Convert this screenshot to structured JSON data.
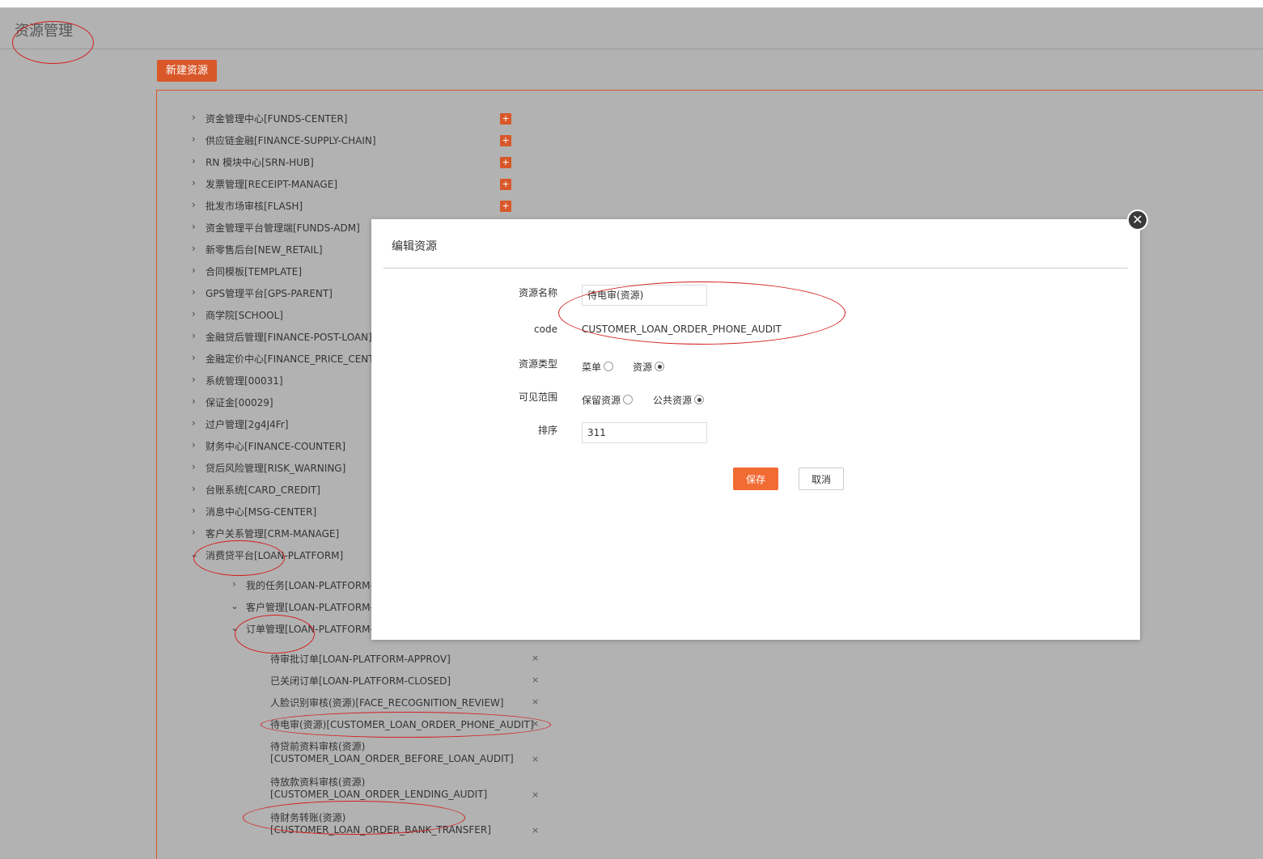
{
  "page": {
    "title": "资源管理",
    "new_button": "新建资源"
  },
  "icons": {
    "chevron_right": "›",
    "chevron_down": "⌄",
    "plus": "+",
    "delete": "×",
    "close": "✕"
  },
  "tree": {
    "top_level": [
      "资金管理中心[FUNDS-CENTER]",
      "供应链金融[FINANCE-SUPPLY-CHAIN]",
      "RN 模块中心[SRN-HUB]",
      "发票管理[RECEIPT-MANAGE]",
      "批发市场审核[FLASH]",
      "资金管理平台管理端[FUNDS-ADM]",
      "新零售后台[NEW_RETAIL]",
      "合同模板[TEMPLATE]",
      "GPS管理平台[GPS-PARENT]",
      "商学院[SCHOOL]",
      "金融贷后管理[FINANCE-POST-LOAN]",
      "金融定价中心[FINANCE_PRICE_CENTER",
      "系统管理[00031]",
      "保证金[00029]",
      "过户管理[2g4J4Fr]",
      "财务中心[FINANCE-COUNTER]",
      "贷后风险管理[RISK_WARNING]",
      "台账系统[CARD_CREDIT]",
      "消息中心[MSG-CENTER]",
      "客户关系管理[CRM-MANAGE]",
      "消费贷平台[LOAN-PLATFORM]"
    ],
    "children": [
      "我的任务[LOAN-PLATFORM-M",
      "客户管理[LOAN-PLATFORM-C",
      "订单管理[LOAN-PLATFORM-C"
    ],
    "grandchildren": [
      {
        "line1": "待审批订单[LOAN-PLATFORM-APPROV]",
        "line2": ""
      },
      {
        "line1": "已关闭订单[LOAN-PLATFORM-CLOSED]",
        "line2": ""
      },
      {
        "line1": "人脸识别审核(资源)[FACE_RECOGNITION_REVIEW]",
        "line2": ""
      },
      {
        "line1": "待电审(资源)[CUSTOMER_LOAN_ORDER_PHONE_AUDIT]",
        "line2": ""
      },
      {
        "line1": "待贷前资料审核(资源)",
        "line2": "[CUSTOMER_LOAN_ORDER_BEFORE_LOAN_AUDIT]"
      },
      {
        "line1": "待放款资料审核(资源)",
        "line2": "[CUSTOMER_LOAN_ORDER_LENDING_AUDIT]"
      },
      {
        "line1": "待财务转账(资源)",
        "line2": "[CUSTOMER_LOAN_ORDER_BANK_TRANSFER]"
      }
    ]
  },
  "modal": {
    "title": "编辑资源",
    "fields": {
      "name_label": "资源名称",
      "name_value": "待电审(资源)",
      "code_label": "code",
      "code_value": "CUSTOMER_LOAN_ORDER_PHONE_AUDIT",
      "type_label": "资源类型",
      "type_option_menu": "菜单",
      "type_option_resource": "资源",
      "scope_label": "可见范围",
      "scope_option_reserved": "保留资源",
      "scope_option_public": "公共资源",
      "sort_label": "排序",
      "sort_value": "311"
    },
    "selected": {
      "type": "资源",
      "scope": "公共资源"
    },
    "save": "保存",
    "cancel": "取消"
  },
  "colors": {
    "accent": "#d8582a",
    "save": "#f26b33",
    "annotation": "#d41f1f",
    "overlay": "#b2b2b2"
  }
}
